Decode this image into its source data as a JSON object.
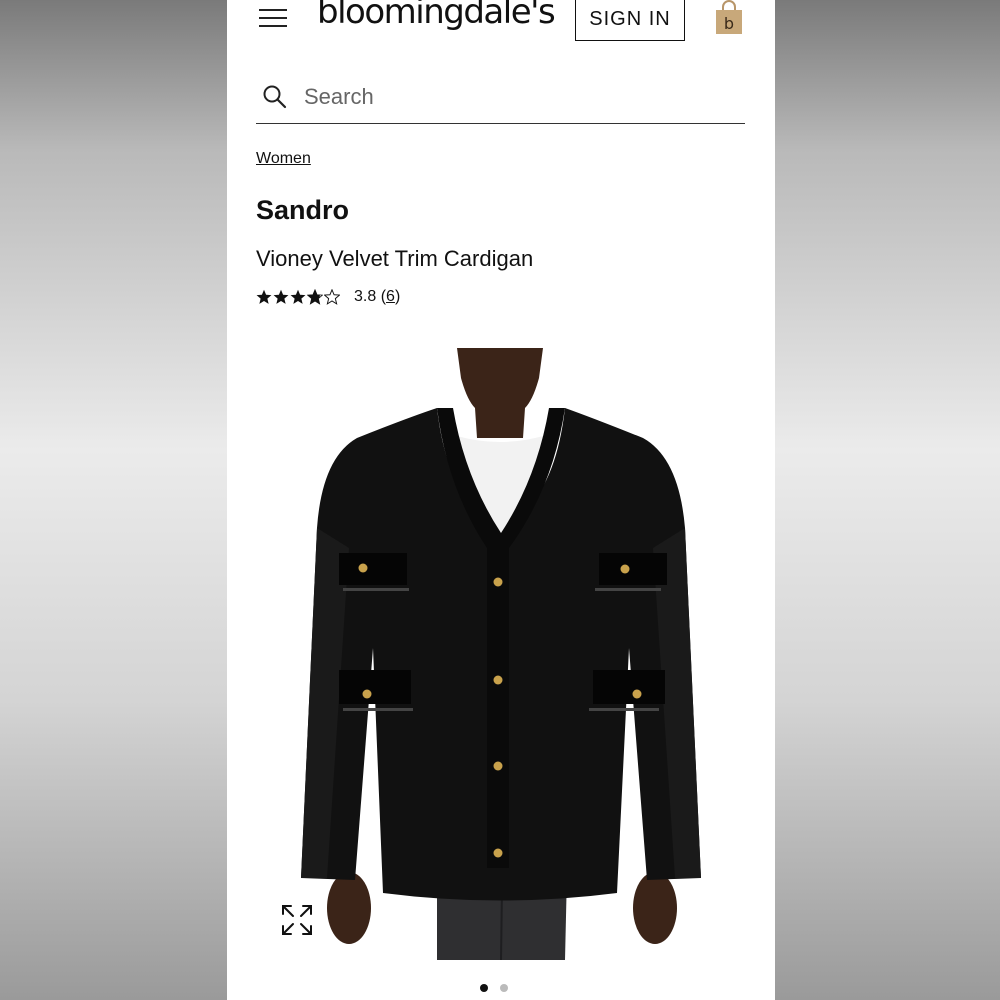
{
  "header": {
    "logo_text": "bloomingdale's",
    "signin_label": "SIGN IN",
    "bag_letter": "b",
    "bag_color": "#c8a87a"
  },
  "search": {
    "placeholder": "Search"
  },
  "breadcrumb": {
    "label": "Women"
  },
  "product": {
    "brand": "Sandro",
    "name": "Vioney Velvet Trim Cardigan",
    "rating_value": "3.8",
    "rating_open": "(",
    "rating_count": "6",
    "rating_close": ")",
    "stars": 3.8
  },
  "gallery": {
    "image_count": 2,
    "active_index": 0,
    "expand_icon": "expand-icon"
  }
}
